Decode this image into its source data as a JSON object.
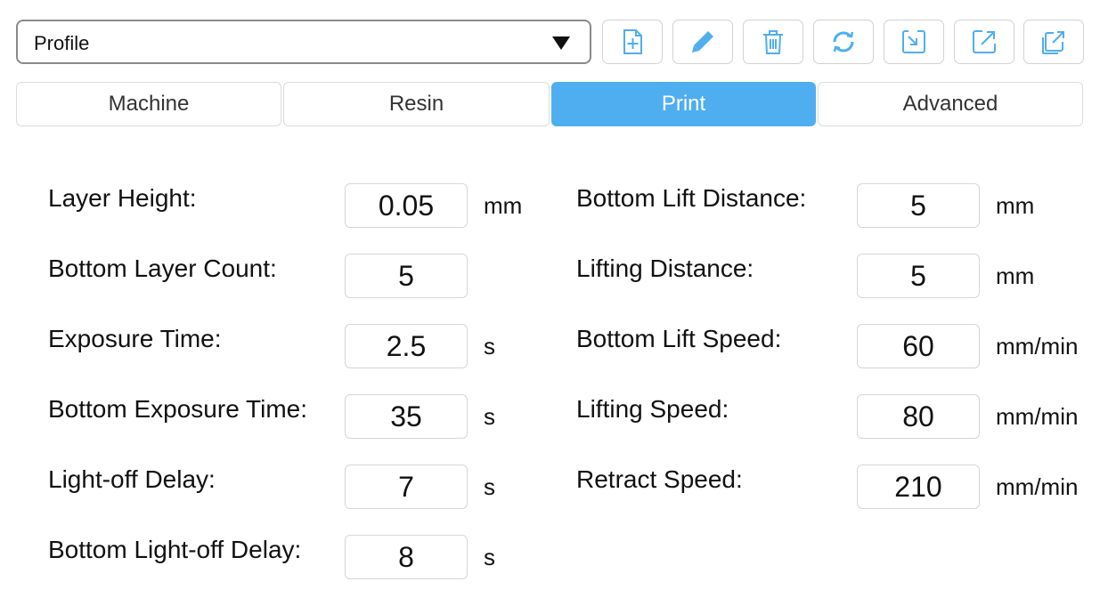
{
  "profile": {
    "selected": "Profile"
  },
  "toolbar": {
    "buttons": [
      {
        "icon": "add-file-icon"
      },
      {
        "icon": "pencil-icon"
      },
      {
        "icon": "trash-icon"
      },
      {
        "icon": "refresh-icon"
      },
      {
        "icon": "import-icon"
      },
      {
        "icon": "export-icon"
      },
      {
        "icon": "export-all-icon"
      }
    ],
    "icon_color": "#4faef0"
  },
  "tabs": [
    {
      "label": "Machine",
      "active": false
    },
    {
      "label": "Resin",
      "active": false
    },
    {
      "label": "Print",
      "active": true
    },
    {
      "label": "Advanced",
      "active": false
    }
  ],
  "form": {
    "left": [
      {
        "label": "Layer Height:",
        "value": "0.05",
        "unit": "mm"
      },
      {
        "label": "Bottom Layer Count:",
        "value": "5",
        "unit": ""
      },
      {
        "label": "Exposure Time:",
        "value": "2.5",
        "unit": "s"
      },
      {
        "label": "Bottom Exposure Time:",
        "value": "35",
        "unit": "s"
      },
      {
        "label": "Light-off Delay:",
        "value": "7",
        "unit": "s"
      },
      {
        "label": "Bottom Light-off Delay:",
        "value": "8",
        "unit": "s"
      }
    ],
    "right": [
      {
        "label": "Bottom Lift Distance:",
        "value": "5",
        "unit": "mm"
      },
      {
        "label": "Lifting Distance:",
        "value": "5",
        "unit": "mm"
      },
      {
        "label": "Bottom Lift Speed:",
        "value": "60",
        "unit": "mm/min"
      },
      {
        "label": "Lifting Speed:",
        "value": "80",
        "unit": "mm/min"
      },
      {
        "label": "Retract Speed:",
        "value": "210",
        "unit": "mm/min"
      }
    ]
  }
}
